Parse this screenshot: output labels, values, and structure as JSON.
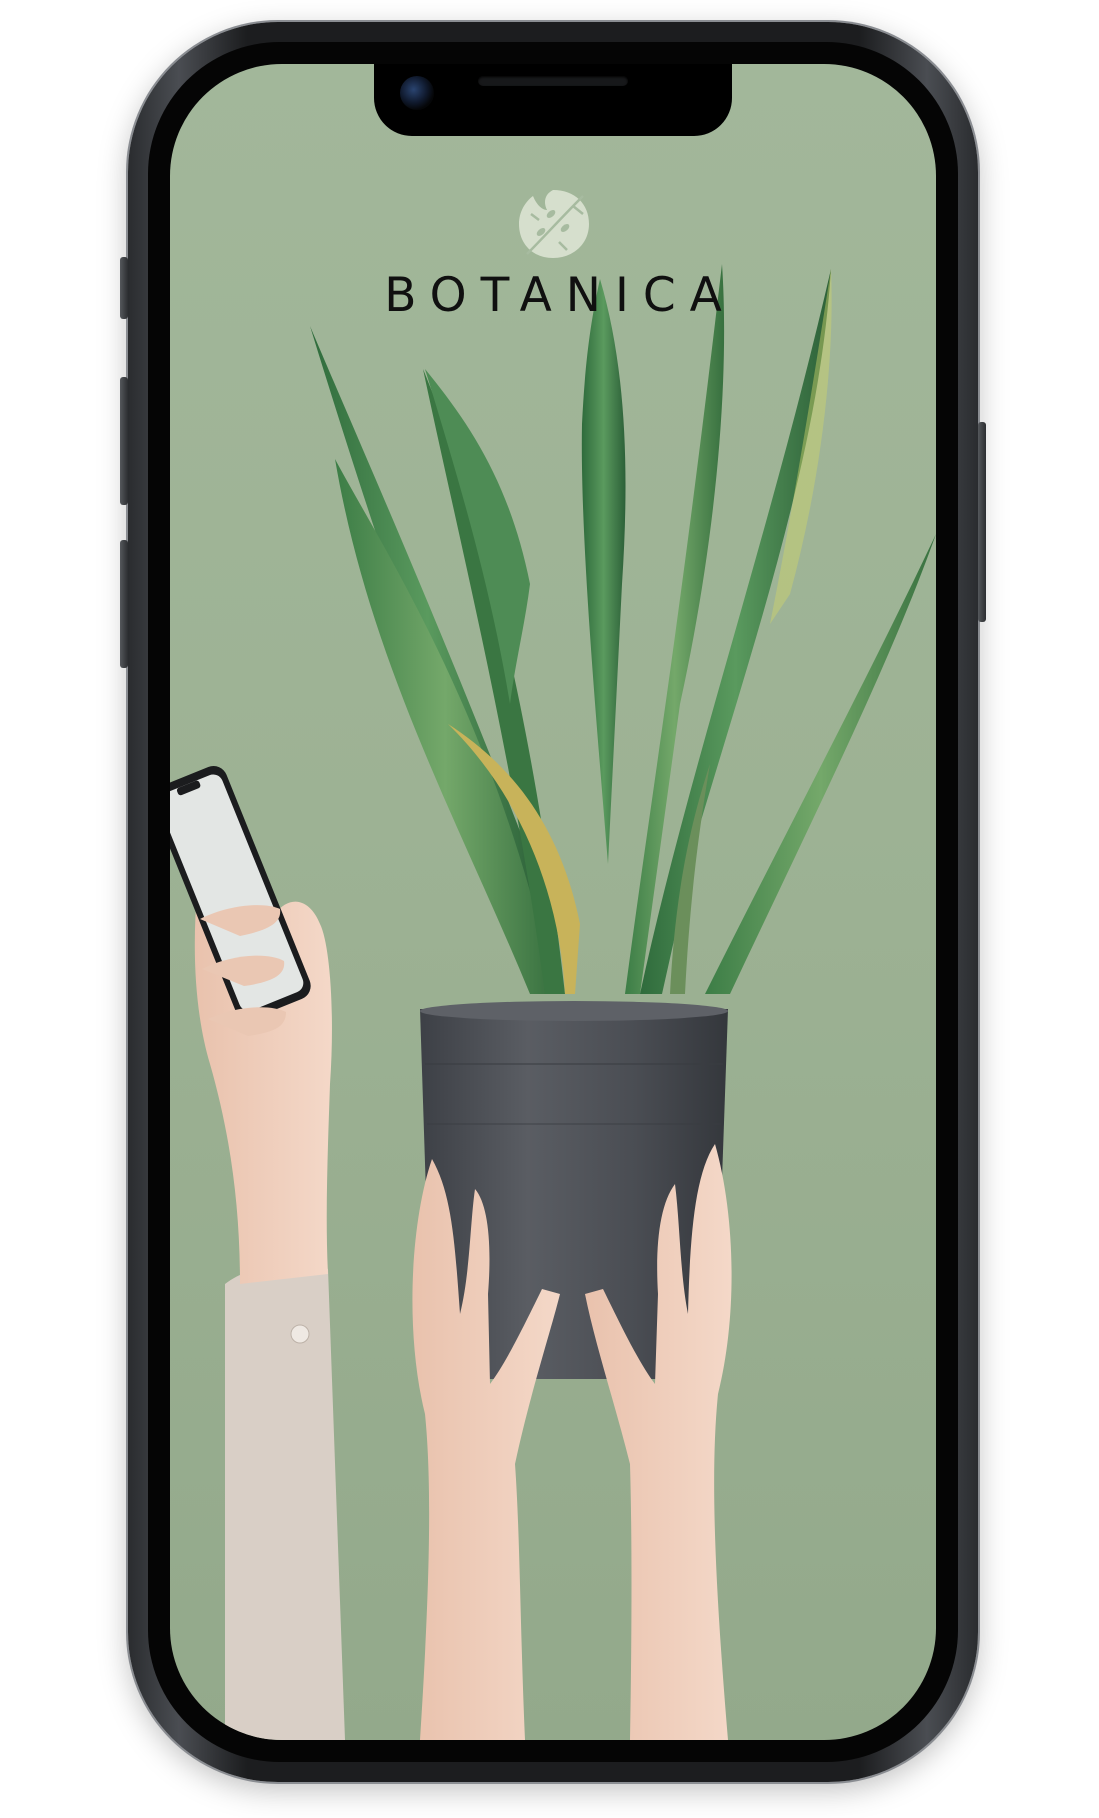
{
  "app": {
    "brand_name": "BOTANICA",
    "logo_icon": "monstera-leaf-icon"
  },
  "device": {
    "type": "smartphone-mockup"
  },
  "hero": {
    "subject_icon": "potted-snake-plant-icon",
    "secondary_icon": "hand-holding-phone-icon"
  },
  "colors": {
    "background": "#9db294",
    "brand_text": "#101010",
    "pot": "#4b4e54",
    "leaf": "#3f7a4a",
    "logo_leaf": "#dfe6d6"
  }
}
